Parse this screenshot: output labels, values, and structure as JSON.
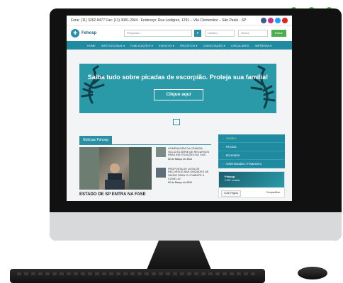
{
  "topbar": {
    "contact": "Fone: (11) 3262-8477  Fax: (11) 3081-2044 · Endereço: Rua Loefgren, 1291 – Vila Clementino – São Paulo · SP",
    "social_icons": [
      "facebook-icon",
      "instagram-icon",
      "twitter-icon",
      "youtube-icon"
    ],
    "social_colors": [
      "#3b5998",
      "#c13584",
      "#1da1f2",
      "#e62117"
    ]
  },
  "header": {
    "logo_text": "Fehosp",
    "search_placeholder": "Pesquisar...",
    "login_user_placeholder": "Usuário",
    "login_pass_placeholder": "Senha",
    "login_button": "Entrar"
  },
  "nav": {
    "items": [
      "Home",
      "Institucional ▾",
      "Publicações ▾",
      "Eventos ▾",
      "Projetos ▾",
      "Capacitação ▾",
      "Circulares",
      "Imprensa ▾"
    ]
  },
  "banner": {
    "title": "Saiba tudo sobre picadas de escorpião. Proteja sua família!",
    "button": "Clique aqui"
  },
  "news": {
    "tab": "Notícias Fehosp",
    "items": [
      {
        "title": "HOMENAGEM DA CÂMARA: SOLICITA SÉRIE DE RECURSOS PARA INSTITUIÇÕES DO SUS",
        "date": "02 de Março de 2021"
      },
      {
        "title": "PROPOSTA DE LISTA DE RECURSOS NAS UNIDADES DE SAÚDE PARA O COMBATE À COVID-19",
        "date": "02 de Março de 2021"
      }
    ],
    "headline": "ESTADO DE SP ENTRA NA FASE"
  },
  "side_menu": {
    "items": [
      "Jurídico",
      "Técnica",
      "Secretaria",
      "Administrativo / Financeiro"
    ]
  },
  "facebook": {
    "name": "Fehosp",
    "subtitle": "3.387 curtidas",
    "like_button": "Curtir Página",
    "share": "Compartilhar"
  },
  "colors": {
    "accent": "#1f8aa0",
    "banner": "#2a9aa8",
    "green": "#4cb050",
    "dots": "#55b657"
  }
}
